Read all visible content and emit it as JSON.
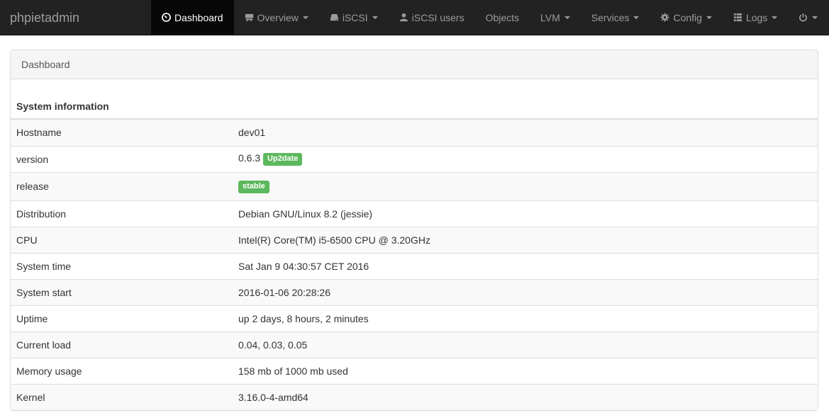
{
  "brand": "phpietadmin",
  "nav": [
    {
      "label": "Dashboard",
      "icon": "dashboard-icon",
      "active": true,
      "dropdown": false
    },
    {
      "label": "Overview",
      "icon": "hdd-icon",
      "active": false,
      "dropdown": true
    },
    {
      "label": "iSCSI",
      "icon": "drive-icon",
      "active": false,
      "dropdown": true
    },
    {
      "label": "iSCSI users",
      "icon": "user-icon",
      "active": false,
      "dropdown": false
    },
    {
      "label": "Objects",
      "icon": "",
      "active": false,
      "dropdown": false
    },
    {
      "label": "LVM",
      "icon": "",
      "active": false,
      "dropdown": true
    },
    {
      "label": "Services",
      "icon": "",
      "active": false,
      "dropdown": true
    },
    {
      "label": "Config",
      "icon": "gear-icon",
      "active": false,
      "dropdown": true
    },
    {
      "label": "Logs",
      "icon": "list-icon",
      "active": false,
      "dropdown": true
    },
    {
      "label": "",
      "icon": "power-icon",
      "active": false,
      "dropdown": true
    }
  ],
  "panel": {
    "heading": "Dashboard",
    "section_title": "System information",
    "rows": [
      {
        "key": "Hostname",
        "value": "dev01"
      },
      {
        "key": "version",
        "value": "0.6.3",
        "badge": "Up2date"
      },
      {
        "key": "release",
        "value": "",
        "badge": "stable"
      },
      {
        "key": "Distribution",
        "value": "Debian GNU/Linux 8.2 (jessie)"
      },
      {
        "key": "CPU",
        "value": "Intel(R) Core(TM) i5-6500 CPU @ 3.20GHz"
      },
      {
        "key": "System time",
        "value": "Sat Jan 9 04:30:57 CET 2016"
      },
      {
        "key": "System start",
        "value": "2016-01-06 20:28:26"
      },
      {
        "key": "Uptime",
        "value": "up 2 days, 8 hours, 2 minutes"
      },
      {
        "key": "Current load",
        "value": "0.04, 0.03, 0.05"
      },
      {
        "key": "Memory usage",
        "value": "158 mb of 1000 mb used"
      },
      {
        "key": "Kernel",
        "value": "3.16.0-4-amd64"
      }
    ]
  },
  "colors": {
    "navbar_bg": "#222222",
    "navbar_active_bg": "#080808",
    "badge_success": "#5cb85c"
  }
}
